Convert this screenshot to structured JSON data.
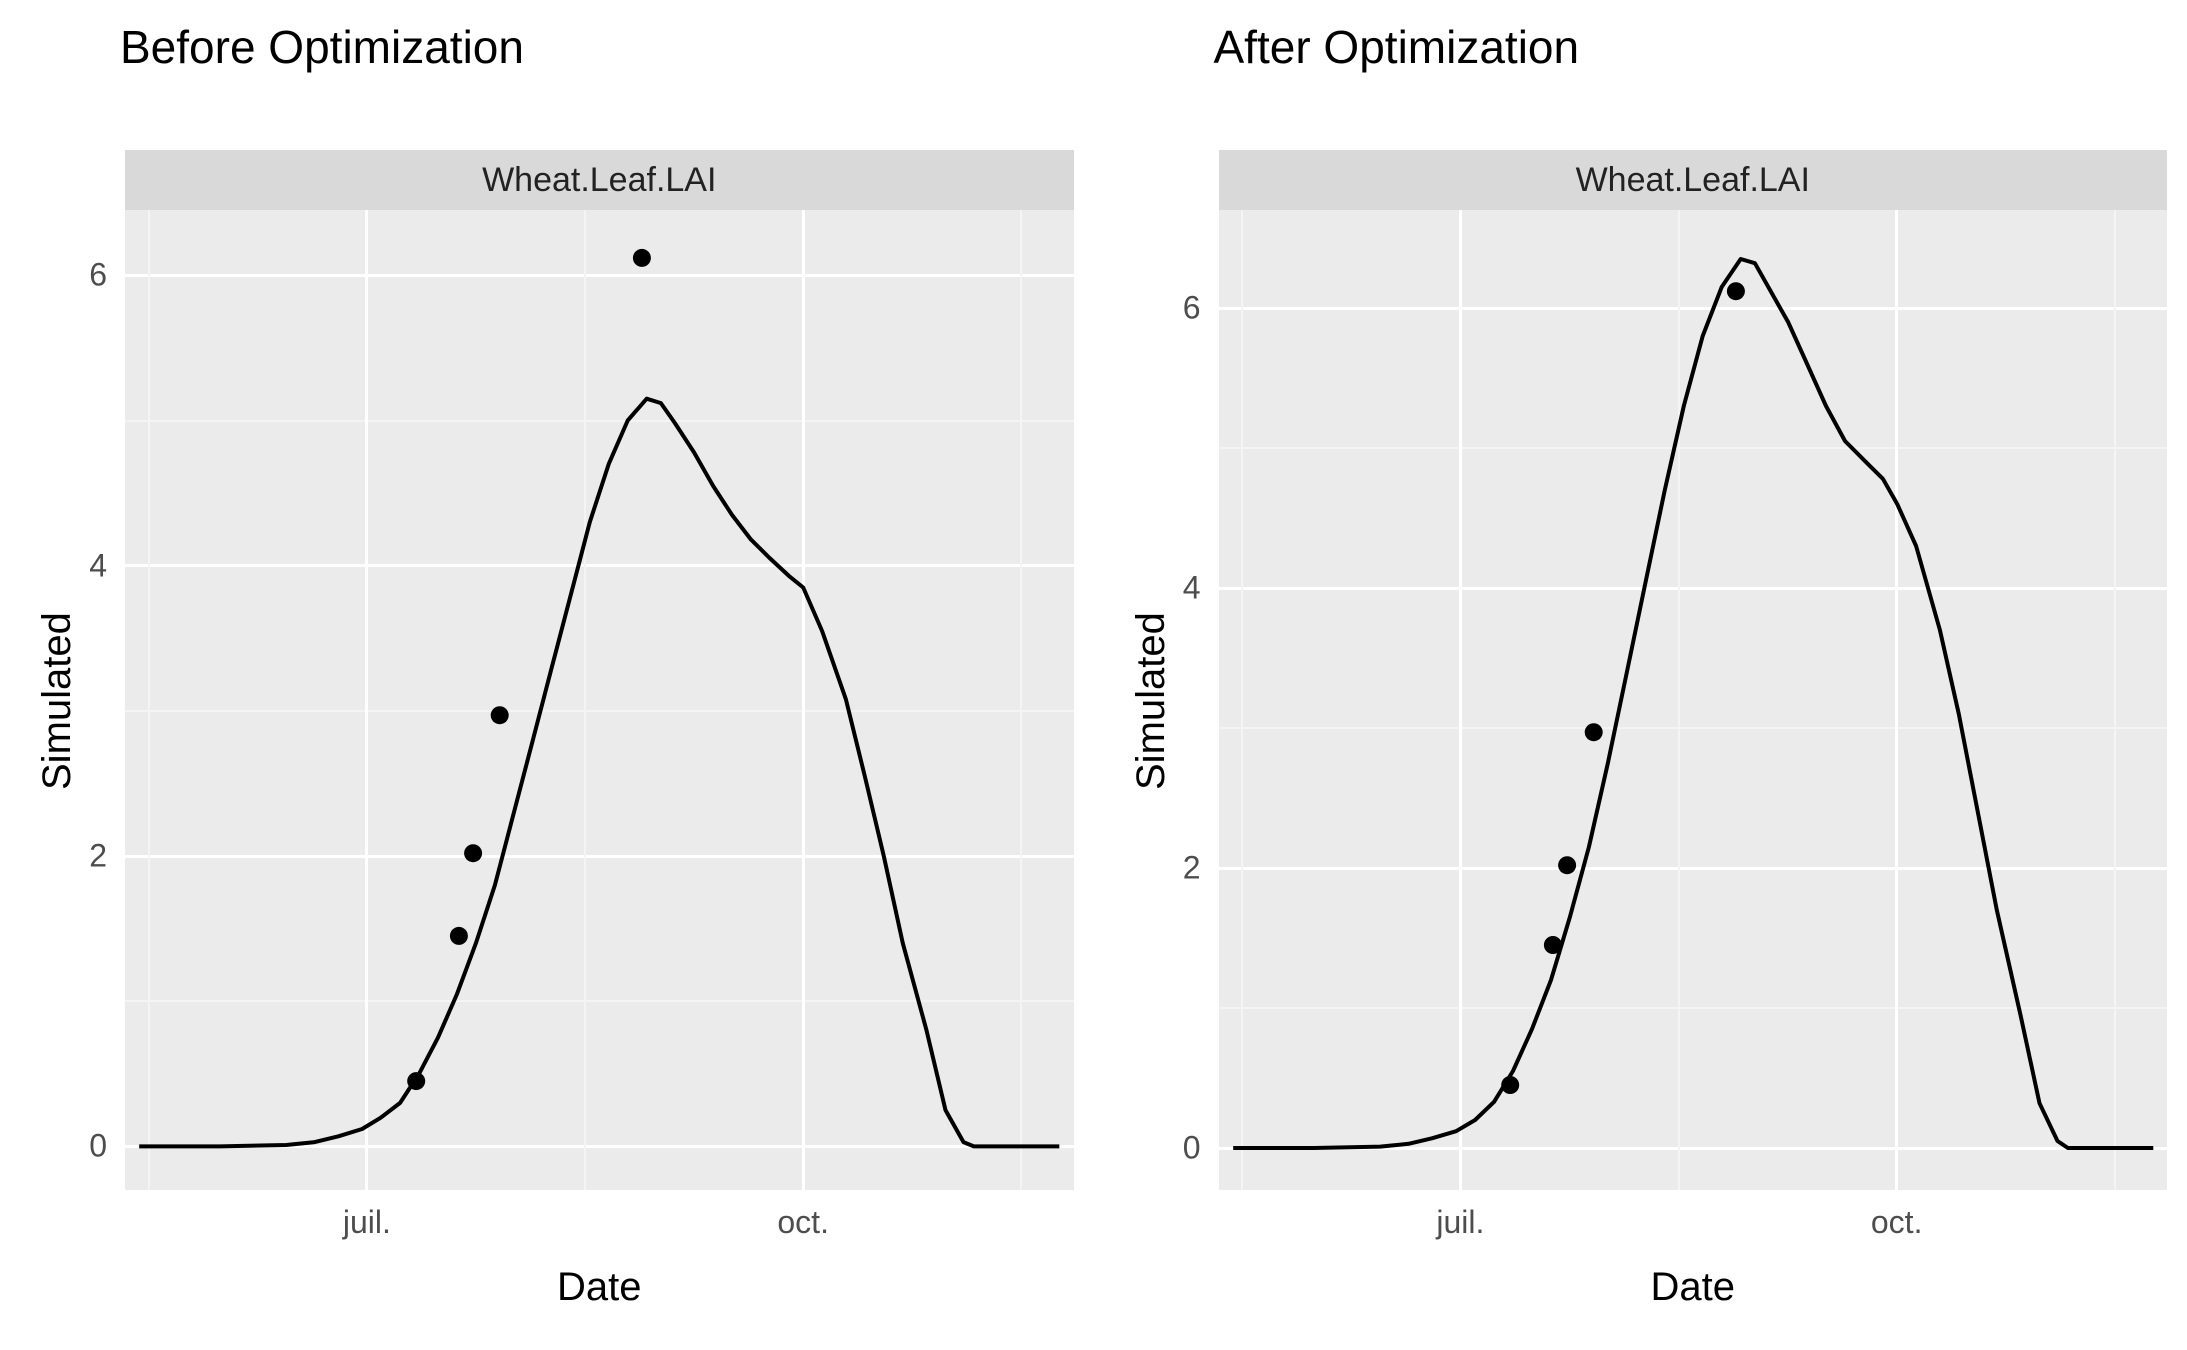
{
  "chart_data": [
    {
      "type": "line",
      "title": "Before Optimization",
      "facet_label": "Wheat.Leaf.LAI",
      "xlabel": "Date",
      "ylabel": "Simulated",
      "x_ticks": [
        {
          "pos": 0.255,
          "label": "juil."
        },
        {
          "pos": 0.715,
          "label": "oct."
        }
      ],
      "y_ticks": [
        {
          "value": 0,
          "label": "0"
        },
        {
          "value": 2,
          "label": "2"
        },
        {
          "value": 4,
          "label": "4"
        },
        {
          "value": 6,
          "label": "6"
        }
      ],
      "ylim": [
        -0.3,
        6.45
      ],
      "series": [
        {
          "name": "simulated-line",
          "kind": "line",
          "color": "#000000",
          "x": [
            0.015,
            0.1,
            0.17,
            0.2,
            0.225,
            0.25,
            0.27,
            0.29,
            0.31,
            0.33,
            0.35,
            0.37,
            0.39,
            0.41,
            0.43,
            0.45,
            0.47,
            0.49,
            0.51,
            0.53,
            0.55,
            0.565,
            0.58,
            0.6,
            0.62,
            0.64,
            0.66,
            0.68,
            0.7,
            0.715,
            0.735,
            0.76,
            0.78,
            0.8,
            0.82,
            0.845,
            0.865,
            0.884,
            0.895,
            0.905,
            0.985
          ],
          "y": [
            0.0,
            0.0,
            0.01,
            0.03,
            0.07,
            0.12,
            0.2,
            0.3,
            0.5,
            0.75,
            1.05,
            1.4,
            1.8,
            2.3,
            2.8,
            3.3,
            3.8,
            4.3,
            4.7,
            5.0,
            5.15,
            5.12,
            4.98,
            4.78,
            4.55,
            4.35,
            4.18,
            4.05,
            3.93,
            3.85,
            3.55,
            3.08,
            2.55,
            2.0,
            1.4,
            0.8,
            0.25,
            0.03,
            0.0,
            0.0,
            0.0
          ]
        },
        {
          "name": "observed-points",
          "kind": "points",
          "color": "#000000",
          "x": [
            0.307,
            0.352,
            0.367,
            0.395,
            0.545
          ],
          "y": [
            0.45,
            1.45,
            2.02,
            2.97,
            6.12
          ]
        }
      ]
    },
    {
      "type": "line",
      "title": "After Optimization",
      "facet_label": "Wheat.Leaf.LAI",
      "xlabel": "Date",
      "ylabel": "Simulated",
      "x_ticks": [
        {
          "pos": 0.255,
          "label": "juil."
        },
        {
          "pos": 0.715,
          "label": "oct."
        }
      ],
      "y_ticks": [
        {
          "value": 0,
          "label": "0"
        },
        {
          "value": 2,
          "label": "2"
        },
        {
          "value": 4,
          "label": "4"
        },
        {
          "value": 6,
          "label": "6"
        }
      ],
      "ylim": [
        -0.3,
        6.7
      ],
      "series": [
        {
          "name": "simulated-line",
          "kind": "line",
          "color": "#000000",
          "x": [
            0.015,
            0.1,
            0.17,
            0.2,
            0.225,
            0.25,
            0.27,
            0.29,
            0.31,
            0.33,
            0.35,
            0.37,
            0.39,
            0.41,
            0.43,
            0.45,
            0.47,
            0.49,
            0.51,
            0.53,
            0.55,
            0.565,
            0.58,
            0.6,
            0.62,
            0.64,
            0.66,
            0.685,
            0.7,
            0.715,
            0.735,
            0.76,
            0.78,
            0.8,
            0.82,
            0.845,
            0.865,
            0.884,
            0.895,
            0.905,
            0.985
          ],
          "y": [
            0.0,
            0.0,
            0.01,
            0.03,
            0.07,
            0.12,
            0.2,
            0.33,
            0.55,
            0.85,
            1.2,
            1.65,
            2.15,
            2.75,
            3.4,
            4.05,
            4.7,
            5.3,
            5.8,
            6.15,
            6.35,
            6.32,
            6.14,
            5.9,
            5.6,
            5.3,
            5.05,
            4.88,
            4.78,
            4.6,
            4.3,
            3.7,
            3.1,
            2.4,
            1.7,
            0.95,
            0.32,
            0.05,
            0.0,
            0.0,
            0.0
          ]
        },
        {
          "name": "observed-points",
          "kind": "points",
          "color": "#000000",
          "x": [
            0.307,
            0.352,
            0.367,
            0.395,
            0.545
          ],
          "y": [
            0.45,
            1.45,
            2.02,
            2.97,
            6.12
          ]
        }
      ]
    }
  ]
}
